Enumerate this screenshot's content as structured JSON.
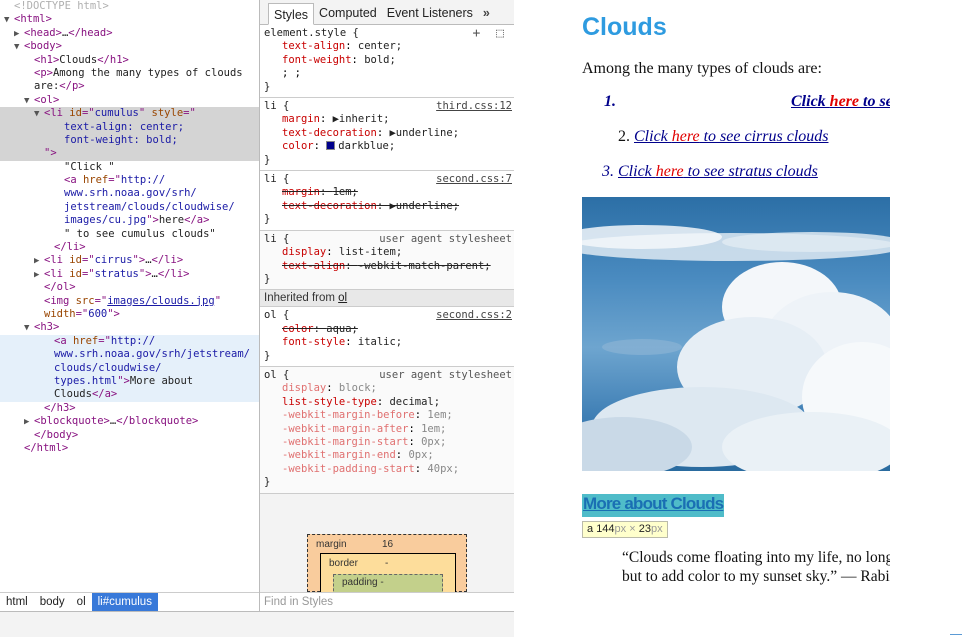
{
  "dom": {
    "lines": [
      {
        "indent": 0,
        "tri": "",
        "parts": [
          {
            "c": "cmt",
            "t": "<!DOCTYPE html>"
          }
        ]
      },
      {
        "indent": 0,
        "tri": "▼",
        "parts": [
          {
            "c": "tag",
            "t": "<html>"
          }
        ]
      },
      {
        "indent": 1,
        "tri": "▶",
        "parts": [
          {
            "c": "tag",
            "t": "<head>"
          },
          {
            "c": "txt",
            "t": "…"
          },
          {
            "c": "tag",
            "t": "</head>"
          }
        ]
      },
      {
        "indent": 1,
        "tri": "▼",
        "parts": [
          {
            "c": "tag",
            "t": "<body>"
          }
        ]
      },
      {
        "indent": 2,
        "tri": "",
        "parts": [
          {
            "c": "tag",
            "t": "<h1>"
          },
          {
            "c": "txt",
            "t": "Clouds"
          },
          {
            "c": "tag",
            "t": "</h1>"
          }
        ]
      },
      {
        "indent": 2,
        "tri": "",
        "parts": [
          {
            "c": "tag",
            "t": "<p>"
          },
          {
            "c": "txt",
            "t": "Among the many types of clouds"
          }
        ]
      },
      {
        "indent": 2,
        "tri": "",
        "parts": [
          {
            "c": "txt",
            "t": "are:"
          },
          {
            "c": "tag",
            "t": "</p>"
          }
        ]
      },
      {
        "indent": 2,
        "tri": "▼",
        "parts": [
          {
            "c": "tag",
            "t": "<ol>"
          }
        ]
      },
      {
        "indent": 3,
        "tri": "▼",
        "sel": true,
        "parts": [
          {
            "c": "tag",
            "t": "<li "
          },
          {
            "c": "attr",
            "t": "id"
          },
          {
            "c": "tag",
            "t": "=\""
          },
          {
            "c": "val",
            "t": "cumulus"
          },
          {
            "c": "tag",
            "t": "\" "
          },
          {
            "c": "attr",
            "t": "style"
          },
          {
            "c": "tag",
            "t": "=\""
          }
        ]
      },
      {
        "indent": 5,
        "tri": "",
        "sel": true,
        "parts": [
          {
            "c": "val",
            "t": "text-align: center;"
          }
        ]
      },
      {
        "indent": 5,
        "tri": "",
        "sel": true,
        "parts": [
          {
            "c": "val",
            "t": "font-weight: bold;"
          }
        ]
      },
      {
        "indent": 3,
        "tri": "",
        "sel": true,
        "parts": [
          {
            "c": "tag",
            "t": "\">"
          }
        ]
      },
      {
        "indent": 5,
        "tri": "",
        "parts": [
          {
            "c": "txt",
            "t": "\"Click \""
          }
        ]
      },
      {
        "indent": 5,
        "tri": "",
        "parts": [
          {
            "c": "tag",
            "t": "<a "
          },
          {
            "c": "attr",
            "t": "href"
          },
          {
            "c": "tag",
            "t": "=\""
          },
          {
            "c": "val",
            "t": "http://"
          }
        ]
      },
      {
        "indent": 5,
        "tri": "",
        "parts": [
          {
            "c": "val",
            "t": "www.srh.noaa.gov/srh/"
          }
        ]
      },
      {
        "indent": 5,
        "tri": "",
        "parts": [
          {
            "c": "val",
            "t": "jetstream/clouds/cloudwise/"
          }
        ]
      },
      {
        "indent": 5,
        "tri": "",
        "parts": [
          {
            "c": "val",
            "t": "images/cu.jpg"
          },
          {
            "c": "tag",
            "t": "\">"
          },
          {
            "c": "txt",
            "t": "here"
          },
          {
            "c": "tag",
            "t": "</a>"
          }
        ]
      },
      {
        "indent": 5,
        "tri": "",
        "parts": [
          {
            "c": "txt",
            "t": "\" to see cumulus clouds\""
          }
        ]
      },
      {
        "indent": 4,
        "tri": "",
        "parts": [
          {
            "c": "tag",
            "t": "</li>"
          }
        ]
      },
      {
        "indent": 3,
        "tri": "▶",
        "parts": [
          {
            "c": "tag",
            "t": "<li "
          },
          {
            "c": "attr",
            "t": "id"
          },
          {
            "c": "tag",
            "t": "=\""
          },
          {
            "c": "val",
            "t": "cirrus"
          },
          {
            "c": "tag",
            "t": "\">"
          },
          {
            "c": "txt",
            "t": "…"
          },
          {
            "c": "tag",
            "t": "</li>"
          }
        ]
      },
      {
        "indent": 3,
        "tri": "▶",
        "parts": [
          {
            "c": "tag",
            "t": "<li "
          },
          {
            "c": "attr",
            "t": "id"
          },
          {
            "c": "tag",
            "t": "=\""
          },
          {
            "c": "val",
            "t": "stratus"
          },
          {
            "c": "tag",
            "t": "\">"
          },
          {
            "c": "txt",
            "t": "…"
          },
          {
            "c": "tag",
            "t": "</li>"
          }
        ]
      },
      {
        "indent": 3,
        "tri": "",
        "parts": [
          {
            "c": "tag",
            "t": "</ol>"
          }
        ]
      },
      {
        "indent": 3,
        "tri": "",
        "parts": [
          {
            "c": "tag",
            "t": "<img "
          },
          {
            "c": "attr",
            "t": "src"
          },
          {
            "c": "tag",
            "t": "=\""
          },
          {
            "c": "lnk",
            "t": "images/clouds.jpg"
          },
          {
            "c": "tag",
            "t": "\""
          }
        ]
      },
      {
        "indent": 3,
        "tri": "",
        "parts": [
          {
            "c": "attr",
            "t": "width"
          },
          {
            "c": "tag",
            "t": "=\""
          },
          {
            "c": "val",
            "t": "600"
          },
          {
            "c": "tag",
            "t": "\">"
          }
        ]
      },
      {
        "indent": 2,
        "tri": "▼",
        "parts": [
          {
            "c": "tag",
            "t": "<h3>"
          }
        ]
      },
      {
        "indent": 4,
        "tri": "",
        "hover": true,
        "parts": [
          {
            "c": "tag",
            "t": "<a "
          },
          {
            "c": "attr",
            "t": "href"
          },
          {
            "c": "tag",
            "t": "=\""
          },
          {
            "c": "val",
            "t": "http://"
          }
        ]
      },
      {
        "indent": 4,
        "tri": "",
        "hover": true,
        "parts": [
          {
            "c": "val",
            "t": "www.srh.noaa.gov/srh/jetstream/"
          }
        ]
      },
      {
        "indent": 4,
        "tri": "",
        "hover": true,
        "parts": [
          {
            "c": "val",
            "t": "clouds/cloudwise/"
          }
        ]
      },
      {
        "indent": 4,
        "tri": "",
        "hover": true,
        "parts": [
          {
            "c": "val",
            "t": "types.html"
          },
          {
            "c": "tag",
            "t": "\">"
          },
          {
            "c": "txt",
            "t": "More about"
          }
        ]
      },
      {
        "indent": 4,
        "tri": "",
        "hover": true,
        "parts": [
          {
            "c": "txt",
            "t": "Clouds"
          },
          {
            "c": "tag",
            "t": "</a>"
          }
        ]
      },
      {
        "indent": 3,
        "tri": "",
        "parts": [
          {
            "c": "tag",
            "t": "</h3>"
          }
        ]
      },
      {
        "indent": 2,
        "tri": "▶",
        "parts": [
          {
            "c": "tag",
            "t": "<blockquote>"
          },
          {
            "c": "txt",
            "t": "…"
          },
          {
            "c": "tag",
            "t": "</blockquote>"
          }
        ]
      },
      {
        "indent": 2,
        "tri": "",
        "parts": [
          {
            "c": "tag",
            "t": "</body>"
          }
        ]
      },
      {
        "indent": 1,
        "tri": "",
        "parts": [
          {
            "c": "tag",
            "t": "</html>"
          }
        ]
      }
    ]
  },
  "breadcrumbs": [
    "html",
    "body",
    "ol",
    "li#cumulus"
  ],
  "styles": {
    "tabs": [
      "Styles",
      "Computed",
      "Event Listeners",
      "»"
    ],
    "element_style": {
      "selector": "element.style {",
      "tools": "+ ⬚",
      "props": [
        [
          "text-align",
          "center;"
        ],
        [
          "font-weight",
          "bold;"
        ]
      ],
      "cursor_line": "; ;"
    },
    "rules": [
      {
        "selector": "li {",
        "src": "third.css:12",
        "ua": false,
        "props": [
          {
            "name": "margin",
            "val": "▶inherit;",
            "state": "normal"
          },
          {
            "name": "text-decoration",
            "val": "▶underline;",
            "state": "normal"
          },
          {
            "name": "color",
            "val": "darkblue;",
            "state": "normal",
            "swatch": true
          }
        ]
      },
      {
        "selector": "li {",
        "src": "second.css:7",
        "ua": false,
        "props": [
          {
            "name": "margin",
            "val": "1em;",
            "state": "strike"
          },
          {
            "name": "text-decoration",
            "val": "▶underline;",
            "state": "strike"
          }
        ]
      },
      {
        "selector": "li {",
        "src": "user agent stylesheet",
        "ua": true,
        "props": [
          {
            "name": "display",
            "val": "list-item;",
            "state": "normal"
          },
          {
            "name": "text-align",
            "val": "-webkit-match-parent;",
            "state": "strike"
          }
        ]
      }
    ],
    "inherited_label": "Inherited from",
    "inherited_from": "ol",
    "inh_rules": [
      {
        "selector": "ol {",
        "src": "second.css:2",
        "ua": false,
        "props": [
          {
            "name": "color",
            "val": "aqua;",
            "state": "strike"
          },
          {
            "name": "font-style",
            "val": "italic;",
            "state": "normal"
          }
        ]
      },
      {
        "selector": "ol {",
        "src": "user agent stylesheet",
        "ua": true,
        "props": [
          {
            "name": "display",
            "val": "block;",
            "state": "dim"
          },
          {
            "name": "list-style-type",
            "val": "decimal;",
            "state": "normal"
          },
          {
            "name": "-webkit-margin-before",
            "val": "1em;",
            "state": "dim"
          },
          {
            "name": "-webkit-margin-after",
            "val": "1em;",
            "state": "dim"
          },
          {
            "name": "-webkit-margin-start",
            "val": "0px;",
            "state": "dim"
          },
          {
            "name": "-webkit-margin-end",
            "val": "0px;",
            "state": "dim"
          },
          {
            "name": "-webkit-padding-start",
            "val": "40px;",
            "state": "dim"
          }
        ]
      }
    ],
    "boxmodel": {
      "margin_label": "margin",
      "margin_val": "16",
      "border_label": "border",
      "border_val": "-",
      "padding_label": "padding -"
    },
    "find_placeholder": "Find in Styles"
  },
  "page": {
    "title": "Clouds",
    "intro": "Among the many types of clouds are:",
    "items": [
      {
        "num": "1.",
        "pre": "Click ",
        "here": "here",
        "post": " to see cumulus clouds",
        "bold": true
      },
      {
        "num": "2.",
        "pre": "Click ",
        "here": "here",
        "post": " to see cirrus clouds",
        "bold": false
      },
      {
        "num": "3.",
        "pre": "Click ",
        "here": "here",
        "post": " to see stratus clouds",
        "bold": false
      }
    ],
    "more_link": "More about Clouds",
    "tooltip": {
      "tag": "a",
      "w": "144",
      "h": "23",
      "unit": "px",
      "x": "×"
    },
    "quote_line1": "“Clouds come floating into my life, no longer to carry rain or usher storm,",
    "quote_line2": "but to add color to my sunset sky.” — Rabindranath Tagore"
  }
}
